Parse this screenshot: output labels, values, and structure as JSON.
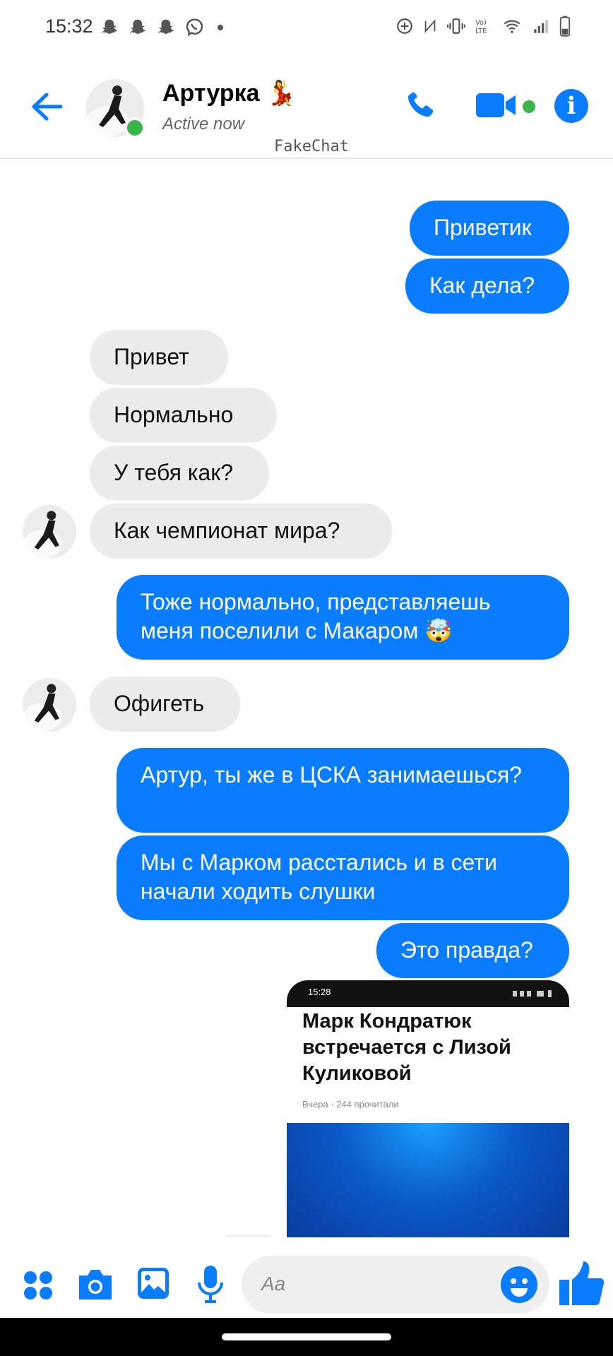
{
  "status_bar": {
    "time": "15:32"
  },
  "header": {
    "contact_name": "Артурка 💃",
    "contact_status": "Active now",
    "watermark": "FakeChat"
  },
  "messages": [
    {
      "side": "out",
      "text": "Приветик"
    },
    {
      "side": "out",
      "text": "Как дела?"
    },
    {
      "side": "in",
      "text": "Привет"
    },
    {
      "side": "in",
      "text": "Нормально"
    },
    {
      "side": "in",
      "text": "У тебя как?"
    },
    {
      "side": "in",
      "text": "Как чемпионат мира?"
    },
    {
      "side": "out",
      "text": "Тоже нормально, представляешь меня поселили с Макаром 🤯"
    },
    {
      "side": "in",
      "text": "Офигеть"
    },
    {
      "side": "out",
      "text": "Артур, ты же в ЦСКА занимаешься?"
    },
    {
      "side": "out",
      "text": "Мы с Марком расстались и в сети начали ходить слушки"
    },
    {
      "side": "out",
      "text": "Это правда?"
    }
  ],
  "shared_card": {
    "time": "15:28",
    "title": "Марк Кондратюк встречается с Лизой Куликовой",
    "meta": "Вчера · 244 прочитали"
  },
  "composer": {
    "placeholder": "Aa"
  },
  "colors": {
    "accent": "#0a7cff",
    "incoming": "#ececec",
    "online": "#3bb54a"
  }
}
